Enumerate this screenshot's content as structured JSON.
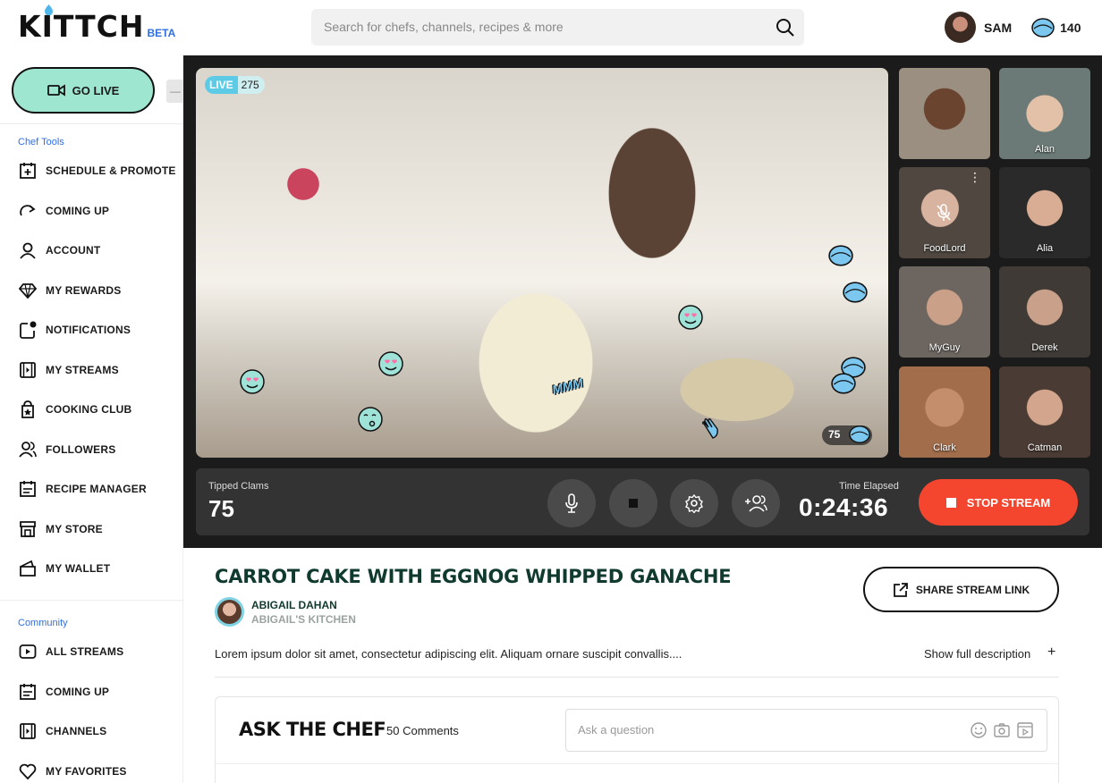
{
  "header": {
    "logo": "KITTCH",
    "logo_badge": "BETA",
    "search_placeholder": "Search for chefs, channels, recipes & more",
    "user_name": "SAM",
    "clam_balance": "140"
  },
  "sidebar": {
    "go_live_label": "GO LIVE",
    "collapse_label": "—",
    "chef_tools_label": "Chef Tools",
    "chef_tools": [
      {
        "label": "SCHEDULE & PROMOTE",
        "icon": "calendar-plus-icon"
      },
      {
        "label": "COMING UP",
        "icon": "forward-icon"
      },
      {
        "label": "ACCOUNT",
        "icon": "user-icon"
      },
      {
        "label": "MY REWARDS",
        "icon": "diamond-icon"
      },
      {
        "label": "NOTIFICATIONS",
        "icon": "notification-icon"
      },
      {
        "label": "MY STREAMS",
        "icon": "streams-icon"
      },
      {
        "label": "COOKING CLUB",
        "icon": "club-icon"
      },
      {
        "label": "FOLLOWERS",
        "icon": "followers-icon"
      },
      {
        "label": "RECIPE MANAGER",
        "icon": "recipe-icon"
      },
      {
        "label": "MY STORE",
        "icon": "store-icon"
      },
      {
        "label": "MY WALLET",
        "icon": "wallet-icon"
      }
    ],
    "community_label": "Community",
    "community": [
      {
        "label": "ALL STREAMS",
        "icon": "play-icon"
      },
      {
        "label": "COMING UP",
        "icon": "calendar-icon"
      },
      {
        "label": "CHANNELS",
        "icon": "channels-icon"
      },
      {
        "label": "MY FAVORITES",
        "icon": "heart-icon"
      }
    ]
  },
  "stream": {
    "live_tag": "LIVE",
    "viewer_count": "275",
    "overlay_tip_count": "75",
    "participants": [
      "",
      "Alan",
      "FoodLord",
      "Alia",
      "MyGuy",
      "Derek",
      "Clark",
      "Catman"
    ],
    "tipped_label": "Tipped Clams",
    "tipped_value": "75",
    "time_label": "Time Elapsed",
    "time_value": "0:24:36",
    "stop_label": "STOP STREAM",
    "emoji_overlay": "MMM",
    "colors": {
      "accent": "#9ee6cf",
      "stop": "#f4452e",
      "live": "#5ecbe6",
      "clam": "#7cc7ef"
    }
  },
  "details": {
    "title": "CARROT CAKE  WITH EGGNOG WHIPPED GANACHE",
    "chef_name": "ABIGAIL DAHAN",
    "chef_kitchen": "ABIGAIL'S KITCHEN",
    "share_label": "SHARE STREAM LINK",
    "description": "Lorem ipsum dolor sit amet, consectetur adipiscing elit. Aliquam ornare suscipit convallis....",
    "show_full": "Show full description",
    "show_plus": "+"
  },
  "ask": {
    "title": "ASK THE CHEF",
    "comments": "50 Comments",
    "placeholder": "Ask a question"
  }
}
